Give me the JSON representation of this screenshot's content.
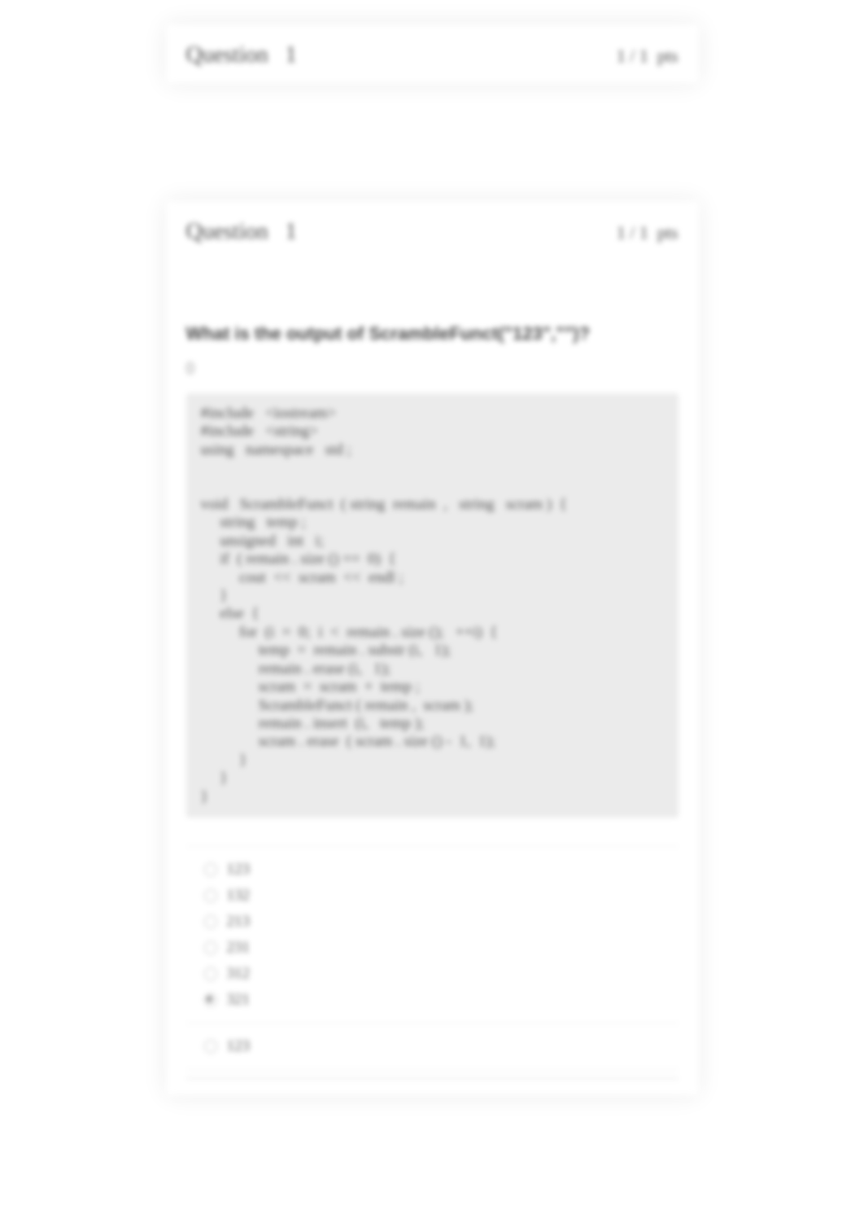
{
  "question_top": {
    "label": "Question",
    "number": "1",
    "score": "1",
    "sep": "/",
    "out_of": "1",
    "pts_label": "pts"
  },
  "question_main": {
    "label": "Question",
    "number": "1",
    "score": "1",
    "sep": "/",
    "out_of": "1",
    "pts_label": "pts",
    "prompt": "What is the output of ScrambleFunct(\"123\",\"\")?",
    "sub": "()",
    "code": "#include   <iostream>\n#include   <string>\nusing   namespace   std ;\n\n\nvoid   ScrambleFunct  ( string  remain  ,   string   scram )  {\n     string   temp ;\n     unsigned   int   i;\n     if  ( remain . size () ==  0)  {\n          cout  <<  scram  <<  endl ;\n     }\n     else  {\n          for  (i  =  0;  i  <  remain . size ();   ++i)  {\n               temp  =  remain . substr (i,   1);\n               remain . erase (i,   1);\n               scram  =  scram  +  temp ;\n               ScrambleFunct ( remain ,  scram );\n               remain . insert  (i,   temp );\n               scram . erase  ( scram . size () -  1,  1);\n          }\n     }\n}",
    "options_a": [
      "123",
      "132",
      "213",
      "231",
      "312",
      "321"
    ],
    "options_b": [
      "123"
    ]
  }
}
